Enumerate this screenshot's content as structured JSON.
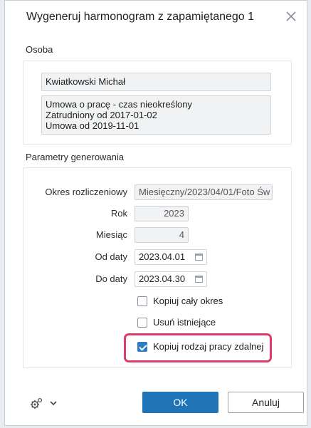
{
  "dialog": {
    "title": "Wygeneruj harmonogram z zapamiętanego 1",
    "close_icon": "close-icon"
  },
  "osoba": {
    "section_label": "Osoba",
    "name": "Kwiatkowski Michał",
    "details": [
      "Umowa o pracę - czas nieokreślony",
      "Zatrudniony od 2017-01-02",
      "Umowa od 2019-11-01"
    ]
  },
  "params": {
    "section_label": "Parametry generowania",
    "okres_label": "Okres rozliczeniowy",
    "okres_value": "Miesięczny/2023/04/01/Foto Św",
    "rok_label": "Rok",
    "rok_value": "2023",
    "miesiac_label": "Miesiąc",
    "miesiac_value": "4",
    "od_label": "Od daty",
    "od_value": "2023.04.01",
    "do_label": "Do daty",
    "do_value": "2023.04.30",
    "checkboxes": [
      {
        "label": "Kopiuj cały okres",
        "checked": false
      },
      {
        "label": "Usuń istniejące",
        "checked": false
      },
      {
        "label": "Kopiuj rodzaj pracy zdalnej",
        "checked": true
      }
    ],
    "highlight_color": "#e03a6a"
  },
  "footer": {
    "settings_icon": "gears-icon",
    "ok_label": "OK",
    "cancel_label": "Anuluj"
  },
  "colors": {
    "accent": "#1f73b7",
    "checkbox_checked": "#2e7bc6"
  }
}
